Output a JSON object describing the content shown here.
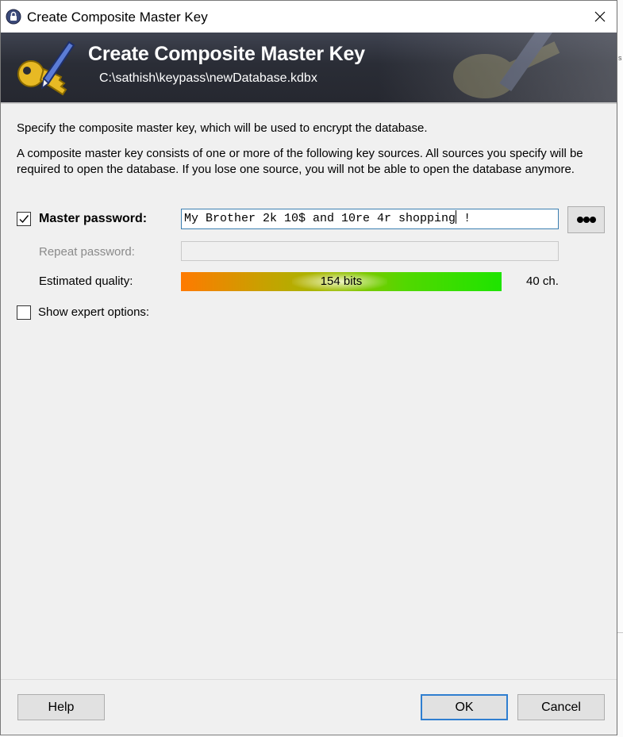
{
  "window": {
    "title": "Create Composite Master Key"
  },
  "banner": {
    "title": "Create Composite Master Key",
    "path": "C:\\sathish\\keypass\\newDatabase.kdbx"
  },
  "description": {
    "line1": "Specify the composite master key, which will be used to encrypt the database.",
    "line2": "A composite master key consists of one or more of the following key sources. All sources you specify will be required to open the database. If you lose one source, you will not be able to open the database anymore."
  },
  "master_password": {
    "label": "Master password:",
    "checked": true,
    "value": "My Brother 2k 10$ and 10re 4r shopping",
    "value_after_caret": " !"
  },
  "repeat_password": {
    "label": "Repeat password:",
    "value": ""
  },
  "quality": {
    "label": "Estimated quality:",
    "bits_text": "154 bits",
    "fill_fraction": 1.0,
    "char_count": "40 ch."
  },
  "expert": {
    "label": "Show expert options:",
    "checked": false
  },
  "buttons": {
    "help": "Help",
    "ok": "OK",
    "cancel": "Cancel"
  },
  "colors": {
    "banner": "#2a2d36",
    "ok_border": "#2f7ed0",
    "input_focus_border": "#3c7fb1"
  }
}
